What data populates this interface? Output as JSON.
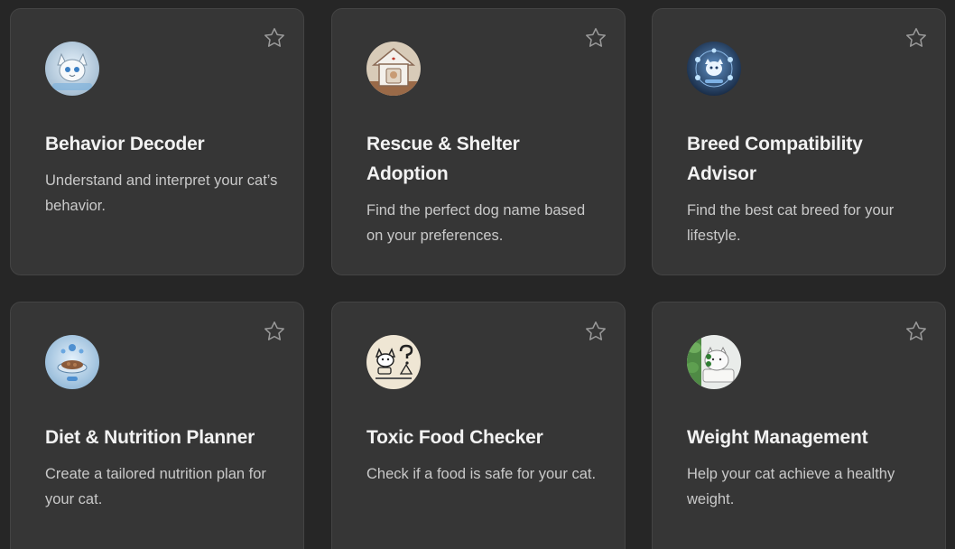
{
  "cards": [
    {
      "title": "Behavior Decoder",
      "description": "Understand and interpret your cat’s behavior.",
      "icon": "cat-robot-icon",
      "favorite_icon": "star-outline-icon"
    },
    {
      "title": "Rescue & Shelter Adoption",
      "description": "Find the perfect dog name based on your preferences.",
      "icon": "pet-shelter-house-icon",
      "favorite_icon": "star-outline-icon"
    },
    {
      "title": "Breed Compatibility Advisor",
      "description": "Find the best cat breed for your lifestyle.",
      "icon": "cat-hologram-icon",
      "favorite_icon": "star-outline-icon"
    },
    {
      "title": "Diet & Nutrition Planner",
      "description": "Create a tailored nutrition plan for your cat.",
      "icon": "food-bowl-icon",
      "favorite_icon": "star-outline-icon"
    },
    {
      "title": "Toxic Food Checker",
      "description": "Check if a food is safe for your cat.",
      "icon": "cat-question-icon",
      "favorite_icon": "star-outline-icon"
    },
    {
      "title": "Weight Management",
      "description": "Help your cat achieve a healthy weight.",
      "icon": "cat-scale-icon",
      "favorite_icon": "star-outline-icon"
    }
  ],
  "colors": {
    "background": "#262626",
    "card": "#363636",
    "card_border": "#444444",
    "title": "#f2f2f2",
    "description": "#c9c9c9",
    "star": "#9a9a9a"
  }
}
